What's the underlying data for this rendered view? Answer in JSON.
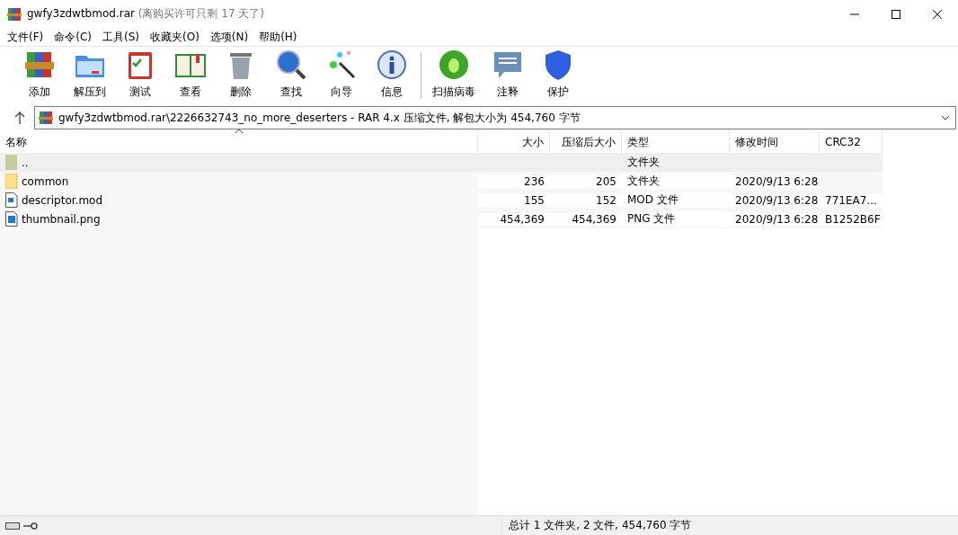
{
  "window": {
    "title": "gwfy3zdwtbmod.rar",
    "title_note": "(离购买许可只剩 17 天了)"
  },
  "menu": [
    "文件(F)",
    "命令(C)",
    "工具(S)",
    "收藏夹(O)",
    "选项(N)",
    "帮助(H)"
  ],
  "toolbar": [
    {
      "kind": "add",
      "label": "添加"
    },
    {
      "kind": "extract",
      "label": "解压到"
    },
    {
      "kind": "test",
      "label": "测试"
    },
    {
      "kind": "view",
      "label": "查看"
    },
    {
      "kind": "delete",
      "label": "删除"
    },
    {
      "kind": "find",
      "label": "查找"
    },
    {
      "kind": "wizard",
      "label": "向导"
    },
    {
      "kind": "info",
      "label": "信息"
    },
    {
      "kind": "separator"
    },
    {
      "kind": "virus",
      "label": "扫描病毒"
    },
    {
      "kind": "comment",
      "label": "注释"
    },
    {
      "kind": "protect",
      "label": "保护"
    }
  ],
  "address": {
    "path": "gwfy3zdwtbmod.rar\\2226632743_no_more_deserters - RAR 4.x 压缩文件, 解包大小为 454,760 字节"
  },
  "table": {
    "columns": [
      "名称",
      "大小",
      "压缩后大小",
      "类型",
      "修改时间",
      "CRC32"
    ],
    "rows": [
      {
        "kind": "parent",
        "name": "..",
        "size": "",
        "packed": "",
        "type": "文件夹",
        "modified": "",
        "crc": "",
        "selected": true
      },
      {
        "kind": "folder",
        "name": "common",
        "size": "236",
        "packed": "205",
        "type": "文件夹",
        "modified": "2020/9/13 6:28",
        "crc": "",
        "selected": false
      },
      {
        "kind": "file",
        "name": "descriptor.mod",
        "size": "155",
        "packed": "152",
        "type": "MOD 文件",
        "modified": "2020/9/13 6:28",
        "crc": "771EA7...",
        "selected": false
      },
      {
        "kind": "image",
        "name": "thumbnail.png",
        "size": "454,369",
        "packed": "454,369",
        "type": "PNG 文件",
        "modified": "2020/9/13 6:28",
        "crc": "B1252B6F",
        "selected": false
      }
    ]
  },
  "status_bar": "总计 1 文件夹, 2 文件, 454,760 字节"
}
